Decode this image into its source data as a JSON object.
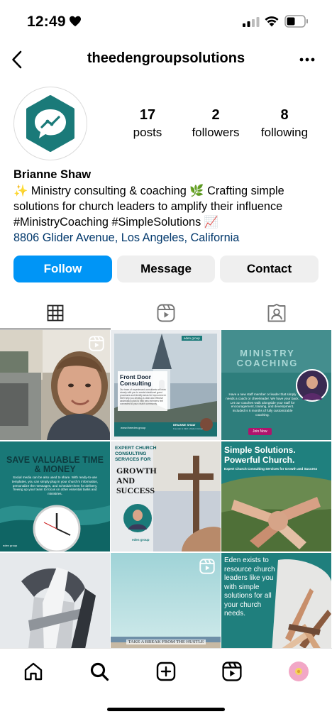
{
  "status_bar": {
    "time": "12:49"
  },
  "header": {
    "username": "theedengroupsolutions"
  },
  "stats": [
    {
      "num": "17",
      "label": "posts"
    },
    {
      "num": "2",
      "label": "followers"
    },
    {
      "num": "8",
      "label": "following"
    }
  ],
  "profile": {
    "name": "Brianne Shaw",
    "bio_line1": "✨ Ministry consulting & coaching 🌿 Crafting simple",
    "bio_line2": "solutions for church leaders to amplify their influence",
    "bio_line3": "#MinistryCoaching #SimpleSolutions 📈",
    "location": "8806 Glider Avenue, Los Angeles, California"
  },
  "buttons": {
    "follow": "Follow",
    "message": "Message",
    "contact": "Contact"
  },
  "posts": [
    {
      "kind": "photo-selfie",
      "reel": true
    },
    {
      "kind": "front-door",
      "title": "Front Door Consulting",
      "body": "Our team of experienced consultants will work closely with you to create intentional guest processes and identify areas for improvement. We'll help you develop a clear and effective assimilation plan to help new members feel connected to your church community.",
      "footer": "www.theeden.group",
      "person": "BRIANNE SHAW",
      "person_role": "Founder & CEO of Eden Group",
      "brand": "eden group"
    },
    {
      "kind": "ministry-coaching",
      "title": "MINISTRY COACHING",
      "body": "Have a new staff member or leader that simply needs a coach or cheerleader. We have your back. Let our coaches walk alongside your staff for encouragement, training, and development. Included is 6 months of fully customizable coaching.",
      "cta": "Join Now"
    },
    {
      "kind": "save-time",
      "title": "SAVE VALUABLE TIME & MONEY",
      "body": "Social media can be also used to share. With ready-to-use templates, you can simply plug in your church's information, personalize the messages, and schedule them for delivery, freeing up your team to focus on other essential tasks and ministries.",
      "brand": "eden group"
    },
    {
      "kind": "expert-services",
      "title": "EXPERT CHURCH CONSULTING SERVICES FOR",
      "highlight": "GROWTH AND SUCCESS",
      "brand": "eden group"
    },
    {
      "kind": "simple-solutions",
      "title": "Simple Solutions. Powerful Church.",
      "subtitle": "Expert Church Consulting Services for Growth and Success"
    },
    {
      "kind": "abstract",
      "reel": false
    },
    {
      "kind": "beach",
      "reel": true,
      "caption": "TAKE A BREAK FROM THE HUSTLE"
    },
    {
      "kind": "eden-exists",
      "text": "Eden exists to resource church leaders like you with simple solutions for all your church needs."
    }
  ],
  "colors": {
    "accent": "#0095f6",
    "teal": "#1a7a79",
    "teal_dark": "#0f5f62",
    "link": "#00376b",
    "button_gray": "#efefef"
  },
  "icons": {
    "status": [
      "heart-icon",
      "signal-icon",
      "wifi-icon",
      "battery-icon"
    ],
    "nav": [
      "back-arrow-icon",
      "more-icon"
    ],
    "tabs": [
      "grid-icon",
      "reels-icon",
      "tagged-icon"
    ],
    "tabbar": [
      "home-icon",
      "search-icon",
      "create-icon",
      "reels-icon",
      "profile-avatar-icon"
    ]
  }
}
